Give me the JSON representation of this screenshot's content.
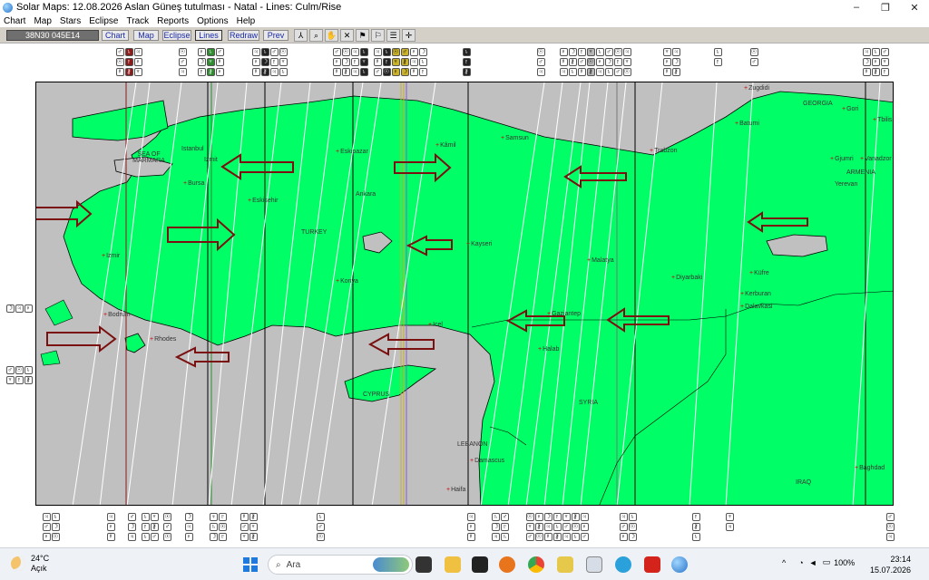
{
  "window": {
    "title": "Solar Maps: 12.08.2026 Aslan Güneş tutulması - Natal - Lines: Culm/Rise",
    "controls": [
      "–",
      "❐",
      "✕"
    ]
  },
  "menu": [
    "Chart",
    "Map",
    "Stars",
    "Eclipse",
    "Track",
    "Reports",
    "Options",
    "Help"
  ],
  "toolbar": {
    "coordinate": "38N30  045E14",
    "buttons": [
      "Chart",
      "Map",
      "Eclipse",
      "Lines",
      "Redraw",
      "Prev"
    ],
    "icons": [
      "person-icon",
      "zoom-icon",
      "hand-icon",
      "crossed-tool-icon",
      "flag-icon",
      "flag2-icon",
      "list-icon",
      "cross-icon"
    ]
  },
  "map": {
    "land_color": "#00ff66",
    "sea_color": "#c0c0c0",
    "labels": {
      "zugdidi": "Zugdidi",
      "georgia": "GEORGIA",
      "gori": "Gori",
      "batumi": "Batumi",
      "tbilisi": "Tbilis",
      "gjumri": "Gjumri",
      "vanadzor": "Vanadzor",
      "armenia": "ARMENIA",
      "yerevan": "Yerevan",
      "samsun": "Samsun",
      "trabzon": "Trabzon",
      "kamil": "Kâmil",
      "istanbul": "Istanbul",
      "izmit": "Izmit",
      "sea_of_marmara": "SEA OF MARMARA",
      "bursa": "Bursa",
      "eskipazar": "Eskipazar",
      "eskisehir": "Eskisehir",
      "ankara": "Ankara",
      "turkey": "TURKEY",
      "kayseri": "Kayseri",
      "izmir": "Izmir",
      "konya": "Konya",
      "malatya": "Malatya",
      "diyarbakir": "Diyarbaki",
      "kufre": "Küfre",
      "kerburan": "Kerburan",
      "dalavakasi": "Dalavkasi",
      "bodrum": "Bodrum",
      "rhodes": "Rhodes",
      "icel": "Icel",
      "gaziantep": "Gaziantep",
      "halab": "Halab",
      "cyprus": "CYPRUS",
      "syria": "SYRIA",
      "lebanon": "LEBANON",
      "damascus": "Damascus",
      "haifa": "Haifa",
      "iraq": "IRAQ",
      "baghdad": "Baghdad"
    }
  },
  "taskbar": {
    "temperature": "24°C",
    "condition": "Açık",
    "search_placeholder": "Ara",
    "battery": "100%",
    "time": "23:14",
    "date": "15.07.2026"
  }
}
